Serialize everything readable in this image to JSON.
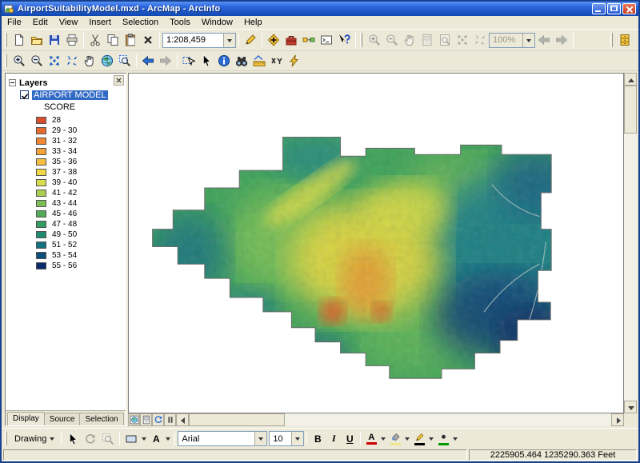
{
  "window": {
    "title": "AirportSuitabilityModel.mxd - ArcMap - ArcInfo"
  },
  "menubar": {
    "items": [
      "File",
      "Edit",
      "View",
      "Insert",
      "Selection",
      "Tools",
      "Window",
      "Help"
    ]
  },
  "standard_toolbar": {
    "scale_value": "1:208,459",
    "layout_zoom_value": "100%"
  },
  "toc": {
    "root_label": "Layers",
    "layer_name": "AIRPORT MODEL",
    "layer_checked": true,
    "legend_field": "SCORE",
    "classes": [
      {
        "label": "28",
        "color": "#D94F2B"
      },
      {
        "label": "29 - 30",
        "color": "#E56B2E"
      },
      {
        "label": "31 - 32",
        "color": "#EE8632"
      },
      {
        "label": "33 - 34",
        "color": "#F3A339"
      },
      {
        "label": "35 - 36",
        "color": "#F6BF40"
      },
      {
        "label": "37 - 38",
        "color": "#F2D848"
      },
      {
        "label": "39 - 40",
        "color": "#D9DC4D"
      },
      {
        "label": "41 - 42",
        "color": "#ABCE51"
      },
      {
        "label": "43 - 44",
        "color": "#7DBE54"
      },
      {
        "label": "45 - 46",
        "color": "#52AC57"
      },
      {
        "label": "47 - 48",
        "color": "#349B61"
      },
      {
        "label": "49 - 50",
        "color": "#1F8A70"
      },
      {
        "label": "51 - 52",
        "color": "#14707C"
      },
      {
        "label": "53 - 54",
        "color": "#0E4E7C"
      },
      {
        "label": "55 - 56",
        "color": "#0A2B6B"
      }
    ],
    "tabs": [
      "Display",
      "Source",
      "Selection"
    ]
  },
  "draw_toolbar": {
    "menu_label": "Drawing",
    "font_name": "Arial",
    "font_size": "10",
    "bold": "B",
    "italic": "I",
    "underline": "U",
    "text_tool_letter": "A",
    "font_color_letter": "A",
    "font_color": "#CC0000",
    "fill_color": "#F0E68C",
    "line_color": "#000000",
    "marker_color": "#009900"
  },
  "statusbar": {
    "coordinates": "2225905.464 1235290.363 Feet"
  },
  "colors": {
    "selection": "#316AC5",
    "toolbar_bg": "#ECE9D8"
  }
}
